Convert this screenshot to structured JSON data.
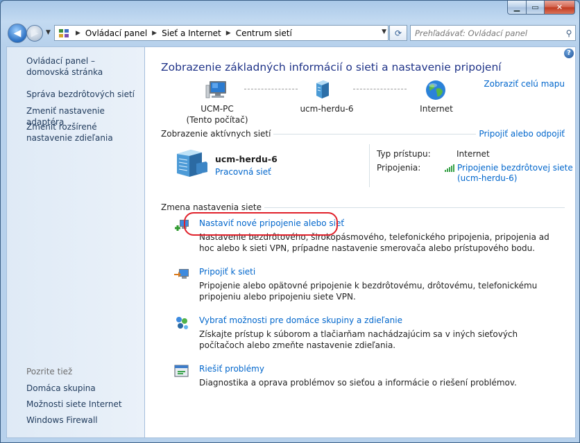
{
  "window": {
    "caption_buttons": [
      "minimize",
      "maximize",
      "close"
    ]
  },
  "navbar": {
    "breadcrumbs": [
      "Ovládací panel",
      "Sieť a Internet",
      "Centrum sietí"
    ],
    "search_placeholder": "Prehľadávať: Ovládací panel"
  },
  "sidebar": {
    "home": "Ovládací panel – domovská stránka",
    "items": [
      "Správa bezdrôtových sietí",
      "Zmeniť nastavenie adaptéra",
      "Zmeniť rozšírené nastavenie zdieľania"
    ],
    "see_also_heading": "Pozrite tiež",
    "see_also": [
      "Domáca skupina",
      "Možnosti siete Internet",
      "Windows Firewall"
    ]
  },
  "main": {
    "title": "Zobrazenie základných informácií o sieti a nastavenie pripojení",
    "full_map_link": "Zobraziť celú mapu",
    "map": {
      "pc_name": "UCM-PC",
      "pc_note": "(Tento počítač)",
      "network": "ucm-herdu-6",
      "internet": "Internet"
    },
    "active": {
      "heading": "Zobrazenie aktívnych sietí",
      "connect_link": "Pripojiť alebo odpojiť",
      "name": "ucm-herdu-6",
      "type": "Pracovná sieť",
      "access_label": "Typ prístupu:",
      "access_value": "Internet",
      "connections_label": "Pripojenia:",
      "connection_line1": "Pripojenie bezdrôtovej siete",
      "connection_line2": "(ucm-herdu-6)"
    },
    "change": {
      "heading": "Zmena nastavenia siete",
      "tasks": [
        {
          "icon": "new-connection-icon",
          "link": "Nastaviť nové pripojenie alebo sieť",
          "desc": "Nastavenie bezdrôtového, širokopásmového, telefonického pripojenia, pripojenia ad hoc alebo k sieti VPN, prípadne nastavenie smerovača alebo prístupového bodu."
        },
        {
          "icon": "connect-network-icon",
          "link": "Pripojiť k sieti",
          "desc": "Pripojenie alebo opätovné pripojenie k bezdrôtovému, drôtovému, telefonickému pripojeniu alebo pripojeniu siete VPN."
        },
        {
          "icon": "homegroup-icon",
          "link": "Vybrať možnosti pre domáce skupiny a zdieľanie",
          "desc": "Získajte prístup k súborom a tlačiarňam nachádzajúcim sa v iných sieťových počítačoch alebo zmeňte nastavenie zdieľania."
        },
        {
          "icon": "troubleshoot-icon",
          "link": "Riešiť problémy",
          "desc": "Diagnostika a oprava problémov so sieťou a informácie o riešení problémov."
        }
      ]
    }
  }
}
